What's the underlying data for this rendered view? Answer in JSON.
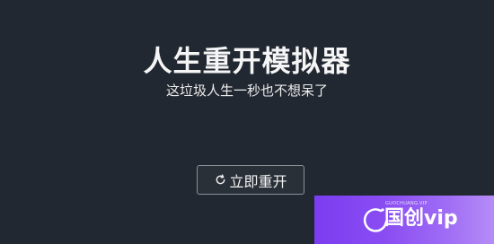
{
  "app": {
    "title": "人生重开模拟器",
    "subtitle": "这垃圾人生一秒也不想呆了"
  },
  "actions": {
    "restart_label": "立即重开",
    "restart_icon": "refresh-icon"
  },
  "watermark": {
    "brand": "国创vip",
    "tagline": "GUOCHUANG.VIP",
    "icon": "logo-arc-icon",
    "gradient_start": "#7b3df0",
    "gradient_end": "#b58cf7"
  },
  "colors": {
    "background": "#222831",
    "text": "#f2f2f2",
    "button_border": "#8b9097"
  }
}
